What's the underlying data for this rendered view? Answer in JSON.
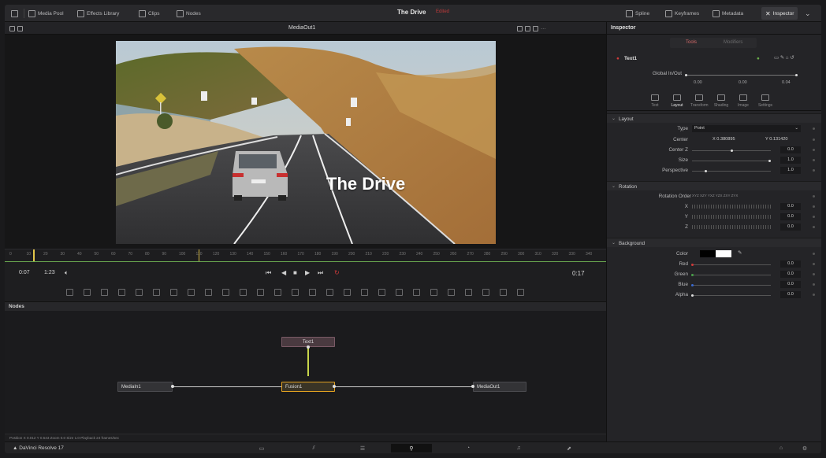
{
  "colors": {
    "accent_red": "#c03a3a",
    "playhead": "#e3c64a",
    "node_selected": "#e0a020",
    "timeline_green": "#6aa84f"
  },
  "topbar": {
    "items": [
      {
        "label": "Media Pool",
        "icon": "media-pool-icon"
      },
      {
        "label": "Effects Library",
        "icon": "effects-library-icon"
      },
      {
        "label": "Clips",
        "icon": "clips-icon"
      },
      {
        "label": "Nodes",
        "icon": "nodes-icon"
      }
    ],
    "project": "The Drive",
    "project_status": "Edited",
    "right_items": [
      {
        "label": "Spline",
        "icon": "spline-icon"
      },
      {
        "label": "Keyframes",
        "icon": "keyframes-icon"
      },
      {
        "label": "Metadata",
        "icon": "metadata-icon"
      }
    ],
    "inspector": "Inspector"
  },
  "viewer": {
    "title": "MediaOut1",
    "overlay_text": "The Drive"
  },
  "ruler": {
    "ticks": [
      "0",
      "10",
      "20",
      "30",
      "40",
      "50",
      "60",
      "70",
      "80",
      "90",
      "100",
      "110",
      "120",
      "130",
      "140",
      "150",
      "160",
      "170",
      "180",
      "190",
      "200",
      "210",
      "220",
      "230",
      "240",
      "250",
      "260",
      "270",
      "280",
      "290",
      "300",
      "310",
      "320",
      "330",
      "340"
    ]
  },
  "transport": {
    "current": "0:07",
    "duration": "1:23",
    "end_time": "0:17"
  },
  "nodes": {
    "header": "Nodes",
    "items": {
      "text": "Text1",
      "media_in": "MediaIn1",
      "transform": "Fusion1",
      "media_out": "MediaOut1"
    }
  },
  "status": "Position  X 0.012 Y 0.543  Zoom 0.0  Size 1.0  Playback 24 frames/sec",
  "bottom": {
    "app": "DaVinci Resolve 17",
    "pages": [
      "media",
      "cut",
      "edit",
      "fusion",
      "color",
      "fairlight",
      "deliver"
    ]
  },
  "inspector": {
    "title": "Inspector",
    "tabs": [
      "Tools",
      "Modifiers"
    ],
    "node_name": "Text1",
    "global_inout_label": "Global In/Out",
    "global_values": [
      "0.00",
      "0.00",
      "0.04"
    ],
    "subtabs": [
      "Text",
      "Layout",
      "Transform",
      "Shading",
      "Image",
      "Settings"
    ],
    "layout": {
      "section": "Layout",
      "type_label": "Type",
      "type_value": "Point",
      "center_label": "Center",
      "center_x": "0.380895",
      "center_y": "0.131420",
      "centerz_label": "Center Z",
      "centerz_value": "0.0",
      "size_label": "Size",
      "size_value": "1.0",
      "perspective_label": "Perspective",
      "perspective_value": "1.0"
    },
    "rotation": {
      "section": "Rotation",
      "order_label": "Rotation Order",
      "order_value": "XYZ  XZY  YXZ  YZX  ZXY  ZYX",
      "x_label": "X",
      "x_value": "0.0",
      "y_label": "Y",
      "y_value": "0.0",
      "z_label": "Z",
      "z_value": "0.0"
    },
    "background": {
      "section": "Background",
      "color_label": "Color",
      "red_label": "Red",
      "red_value": "0.0",
      "green_label": "Green",
      "green_value": "0.0",
      "blue_label": "Blue",
      "blue_value": "0.0",
      "alpha_label": "Alpha",
      "alpha_value": "0.0"
    }
  }
}
